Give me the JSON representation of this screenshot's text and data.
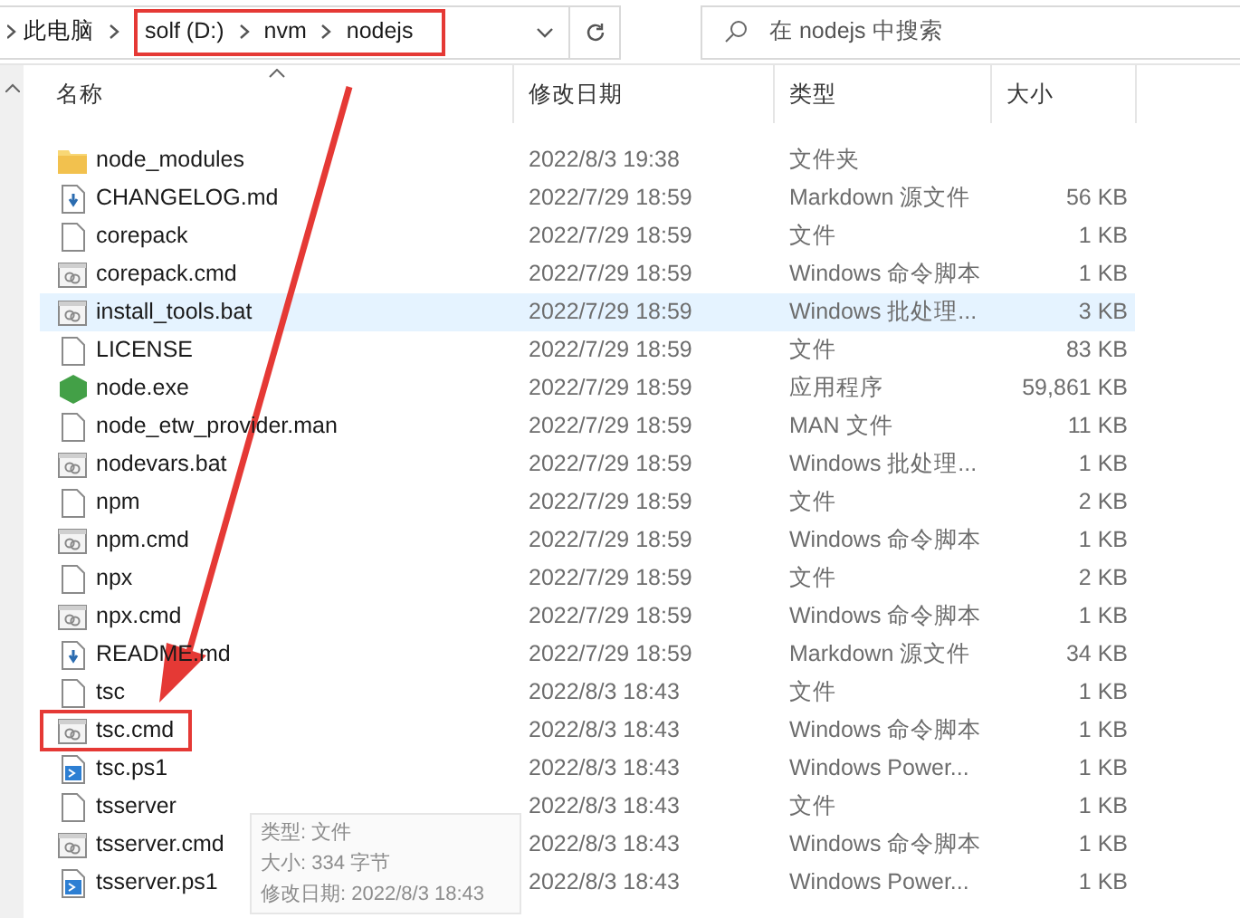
{
  "address_bar": {
    "root": "此电脑",
    "path": [
      "solf (D:)",
      "nvm",
      "nodejs"
    ],
    "path_boxed": true
  },
  "search": {
    "placeholder": "在 nodejs 中搜索"
  },
  "columns": [
    {
      "label": "名称",
      "sorted": true
    },
    {
      "label": "修改日期",
      "sorted": false
    },
    {
      "label": "类型",
      "sorted": false
    },
    {
      "label": "大小",
      "sorted": false
    }
  ],
  "rows": [
    {
      "kind": "folder",
      "name": "node_modules",
      "date": "2022/8/3 19:38",
      "type": "文件夹",
      "hovered": false,
      "boxed": false
    },
    {
      "kind": "md",
      "name": "CHANGELOG.md",
      "date": "2022/7/29 18:59",
      "type": "Markdown 源文件",
      "size": "56 KB",
      "hovered": false,
      "boxed": false
    },
    {
      "kind": "file",
      "name": "corepack",
      "date": "2022/7/29 18:59",
      "type": "文件",
      "size": "1 KB",
      "hovered": false,
      "boxed": false
    },
    {
      "kind": "cmd",
      "name": "corepack.cmd",
      "date": "2022/7/29 18:59",
      "type": "Windows 命令脚本",
      "size": "1 KB",
      "hovered": false,
      "boxed": false
    },
    {
      "kind": "cmd",
      "name": "install_tools.bat",
      "date": "2022/7/29 18:59",
      "type": "Windows 批处理...",
      "size": "3 KB",
      "hovered": true,
      "boxed": false
    },
    {
      "kind": "file",
      "name": "LICENSE",
      "date": "2022/7/29 18:59",
      "type": "文件",
      "size": "83 KB",
      "hovered": false,
      "boxed": false
    },
    {
      "kind": "exe",
      "name": "node.exe",
      "date": "2022/7/29 18:59",
      "type": "应用程序",
      "size": "59,861 KB",
      "hovered": false,
      "boxed": false
    },
    {
      "kind": "file",
      "name": "node_etw_provider.man",
      "date": "2022/7/29 18:59",
      "type": "MAN 文件",
      "size": "11 KB",
      "hovered": false,
      "boxed": false
    },
    {
      "kind": "cmd",
      "name": "nodevars.bat",
      "date": "2022/7/29 18:59",
      "type": "Windows 批处理...",
      "size": "1 KB",
      "hovered": false,
      "boxed": false
    },
    {
      "kind": "file",
      "name": "npm",
      "date": "2022/7/29 18:59",
      "type": "文件",
      "size": "2 KB",
      "hovered": false,
      "boxed": false
    },
    {
      "kind": "cmd",
      "name": "npm.cmd",
      "date": "2022/7/29 18:59",
      "type": "Windows 命令脚本",
      "size": "1 KB",
      "hovered": false,
      "boxed": false
    },
    {
      "kind": "file",
      "name": "npx",
      "date": "2022/7/29 18:59",
      "type": "文件",
      "size": "2 KB",
      "hovered": false,
      "boxed": false
    },
    {
      "kind": "cmd",
      "name": "npx.cmd",
      "date": "2022/7/29 18:59",
      "type": "Windows 命令脚本",
      "size": "1 KB",
      "hovered": false,
      "boxed": false
    },
    {
      "kind": "md",
      "name": "README.md",
      "date": "2022/7/29 18:59",
      "type": "Markdown 源文件",
      "size": "34 KB",
      "hovered": false,
      "boxed": false
    },
    {
      "kind": "file",
      "name": "tsc",
      "date": "2022/8/3 18:43",
      "type": "文件",
      "size": "1 KB",
      "hovered": false,
      "boxed": false
    },
    {
      "kind": "cmd",
      "name": "tsc.cmd",
      "date": "2022/8/3 18:43",
      "type": "Windows 命令脚本",
      "size": "1 KB",
      "hovered": false,
      "boxed": true
    },
    {
      "kind": "ps1",
      "name": "tsc.ps1",
      "date": "2022/8/3 18:43",
      "type": "Windows Power...",
      "size": "1 KB",
      "hovered": false,
      "boxed": false
    },
    {
      "kind": "file",
      "name": "tsserver",
      "date": "2022/8/3 18:43",
      "type": "文件",
      "size": "1 KB",
      "hovered": false,
      "boxed": false
    },
    {
      "kind": "cmd",
      "name": "tsserver.cmd",
      "date": "2022/8/3 18:43",
      "type": "Windows 命令脚本",
      "size": "1 KB",
      "hovered": false,
      "boxed": false
    },
    {
      "kind": "ps1",
      "name": "tsserver.ps1",
      "date": "2022/8/3 18:43",
      "type": "Windows Power...",
      "size": "1 KB",
      "hovered": false,
      "boxed": false
    }
  ],
  "tooltip": {
    "lines": [
      "类型: 文件",
      "大小: 334 字节",
      "修改日期: 2022/8/3 18:43"
    ]
  },
  "annotation_arrow": true
}
